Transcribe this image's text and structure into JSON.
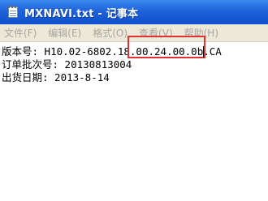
{
  "window": {
    "title": "MXNAVI.txt - 记事本",
    "icon": "notepad-icon"
  },
  "menu": {
    "items": [
      "文件(F)",
      "编辑(E)",
      "格式(O)",
      "查看(V)",
      "帮助(H)"
    ]
  },
  "document": {
    "lines": [
      "版本号: H10.02-6802.18.00.24.00.0b.CA",
      "订单批次号: 20130813004",
      "出货日期: 2013-8-14"
    ]
  },
  "annotation": {
    "highlight_color": "#e03232",
    "highlighted_text": "18.00.24.00"
  }
}
